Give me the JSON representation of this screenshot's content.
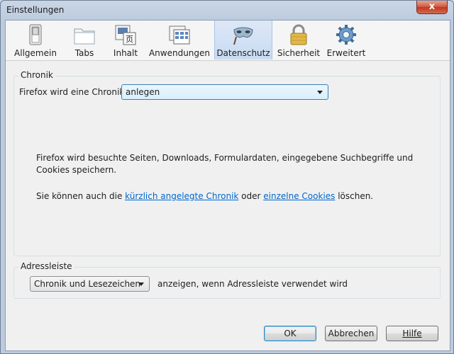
{
  "window": {
    "title": "Einstellungen",
    "close_glyph": "x"
  },
  "toolbar": {
    "panes": [
      {
        "label": "Allgemein",
        "icon": "switch-icon"
      },
      {
        "label": "Tabs",
        "icon": "tabs-icon"
      },
      {
        "label": "Inhalt",
        "icon": "content-icon"
      },
      {
        "label": "Anwendungen",
        "icon": "applications-icon"
      },
      {
        "label": "Datenschutz",
        "icon": "mask-icon",
        "selected": true
      },
      {
        "label": "Sicherheit",
        "icon": "padlock-icon"
      },
      {
        "label": "Erweitert",
        "icon": "gear-icon"
      }
    ]
  },
  "history": {
    "group_title": "Chronik",
    "label": "Firefox wird eine Chronik:",
    "mode_value": "anlegen",
    "description": "Firefox wird besuchte Seiten, Downloads, Formulardaten, eingegebene Suchbegriffe und Cookies speichern.",
    "clear_prefix": "Sie können auch die ",
    "clear_link_history": "kürzlich angelegte Chronik",
    "clear_middle": " oder ",
    "clear_link_cookies": "einzelne Cookies",
    "clear_suffix": " löschen."
  },
  "location_bar": {
    "group_title": "Adressleiste",
    "suggest_value": "Chronik und Lesezeichen",
    "suffix": "anzeigen, wenn Adressleiste verwendet wird"
  },
  "buttons": {
    "ok": "OK",
    "cancel": "Abbrechen",
    "help": "Hilfe"
  },
  "colors": {
    "link": "#0066cc",
    "selected_tab": "#c8dbf2",
    "close_button": "#c1381e"
  }
}
